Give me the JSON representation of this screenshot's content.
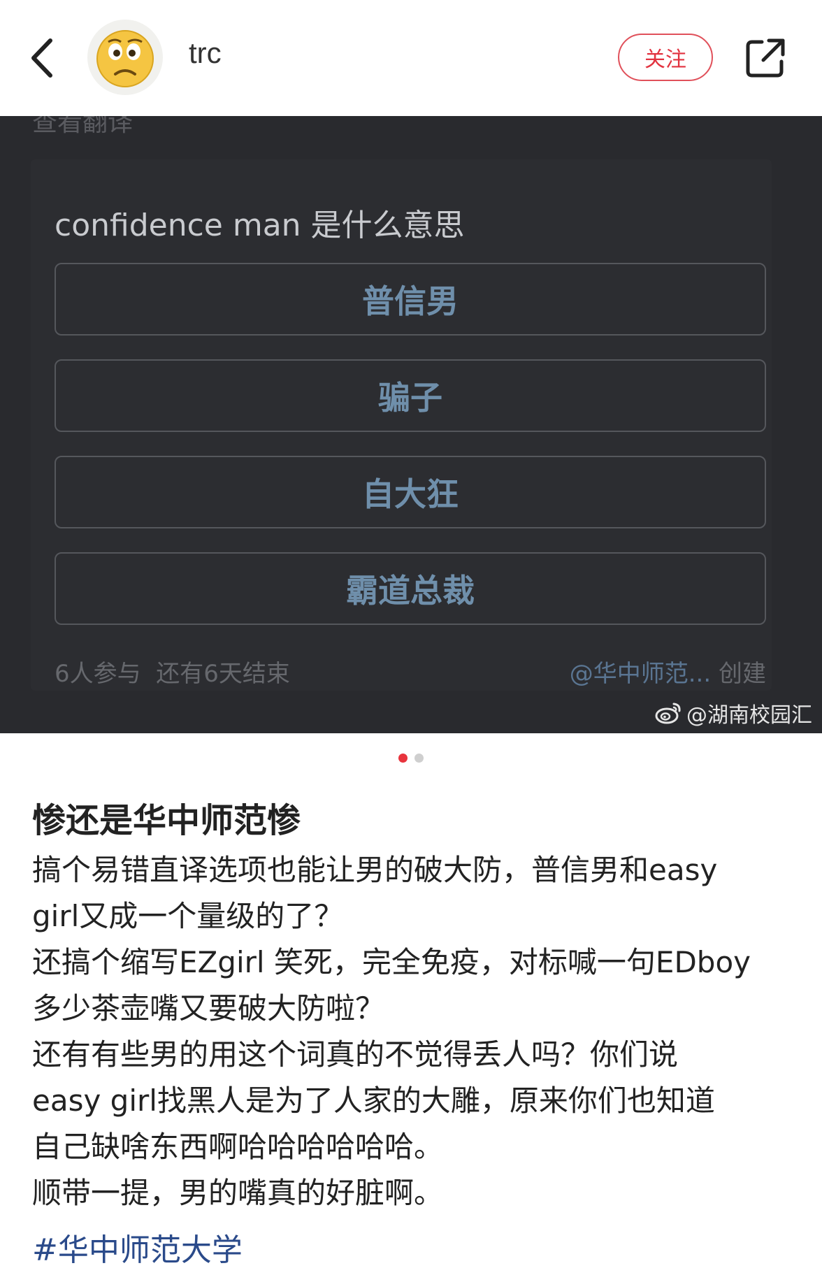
{
  "header": {
    "username": "trc",
    "follow_label": "关注",
    "icons": {
      "back": "chevron-left-icon",
      "share": "share-icon",
      "avatar": "emoji-worried-face"
    }
  },
  "image": {
    "translate_hint": "查看翻译",
    "poll": {
      "question": "confidence man 是什么意思",
      "options": [
        "普信男",
        "骗子",
        "自大狂",
        "霸道总裁"
      ],
      "footer_left": "6人参与  还有6天结束",
      "footer_right_mention": "@华中师范...",
      "footer_right_suffix": " 创建"
    },
    "watermark": "@湖南校园汇"
  },
  "pagination": {
    "total": 2,
    "current": 1
  },
  "post": {
    "title": "惨还是华中师范惨",
    "body_lines": [
      "搞个易错直译选项也能让男的破大防，普信男和easy",
      "girl又成一个量级的了？",
      "还搞个缩写EZgirl 笑死，完全免疫，对标喊一句EDboy",
      "多少茶壶嘴又要破大防啦？",
      "还有有些男的用这个词真的不觉得丢人吗？你们说",
      "easy girl找黑人是为了人家的大雕，原来你们也知道",
      "自己缺啥东西啊哈哈哈哈哈哈。",
      "顺带一提，男的嘴真的好脏啊。"
    ],
    "hashtag": "#华中师范大学"
  },
  "colors": {
    "accent": "#e2323f",
    "poll_option_text": "#6f8fab",
    "hashtag": "#2a4a8a",
    "image_bg": "#292a2e"
  }
}
